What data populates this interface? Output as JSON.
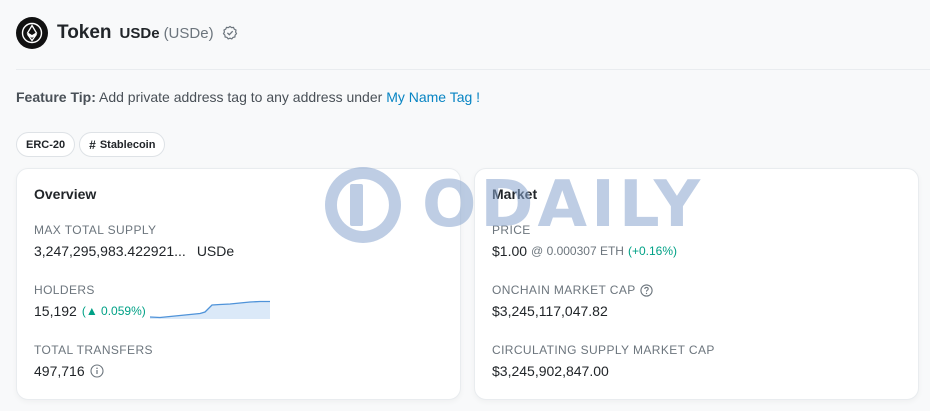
{
  "header": {
    "title": "Token",
    "name": "USDe",
    "symbol": "(USDe)"
  },
  "feature_tip": {
    "label": "Feature Tip:",
    "text": "Add private address tag to any address under",
    "link": "My Name Tag !"
  },
  "tags": [
    {
      "label": "ERC-20"
    },
    {
      "label": "Stablecoin",
      "icon": "hash-icon"
    }
  ],
  "overview": {
    "title": "Overview",
    "max_supply": {
      "label": "MAX TOTAL SUPPLY",
      "value": "3,247,295,983.422921...",
      "unit": "USDe"
    },
    "holders": {
      "label": "HOLDERS",
      "value": "15,192",
      "change": "(▲ 0.059%)"
    },
    "transfers": {
      "label": "TOTAL TRANSFERS",
      "value": "497,716"
    }
  },
  "market": {
    "title": "Market",
    "price": {
      "label": "PRICE",
      "value": "$1.00",
      "eth": "@ 0.000307 ETH",
      "change": "(+0.16%)"
    },
    "onchain_cap": {
      "label": "ONCHAIN MARKET CAP",
      "value": "$3,245,117,047.82"
    },
    "circ_cap": {
      "label": "CIRCULATING SUPPLY MARKET CAP",
      "value": "$3,245,902,847.00"
    }
  },
  "watermark": {
    "text": "ODAILY"
  },
  "colors": {
    "link": "#0784c3",
    "positive": "#00a186",
    "sparkline": "#4f93d9"
  }
}
